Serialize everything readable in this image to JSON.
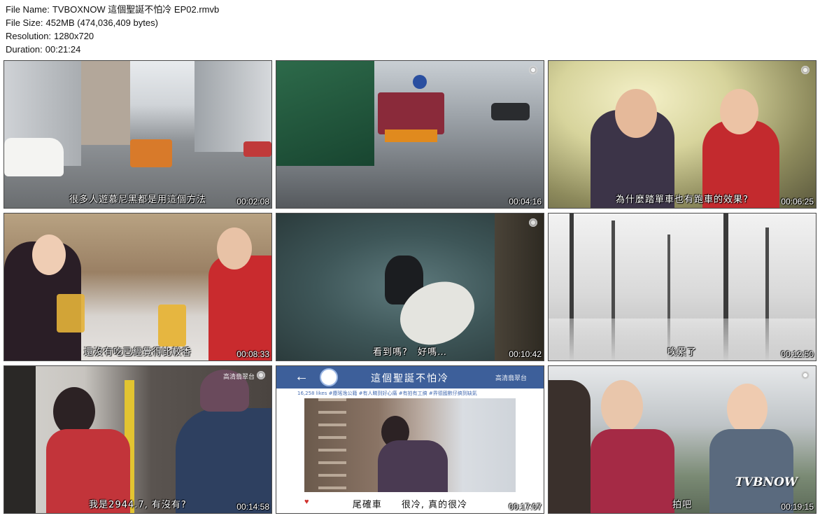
{
  "file_info": {
    "name_label": "File Name:",
    "name_value": "TVBOXNOW 這個聖誕不怕冷 EP02.rmvb",
    "size_label": "File Size:",
    "size_value": "452MB (474,036,409 bytes)",
    "resolution_label": "Resolution:",
    "resolution_value": "1280x720",
    "duration_label": "Duration:",
    "duration_value": "00:21:24"
  },
  "thumbnails": [
    {
      "subtitle": "很多人遊慕尼黑都是用這個方法",
      "time": "00:02:08",
      "tvb": ""
    },
    {
      "subtitle": "",
      "time": "00:04:16",
      "tvb": ""
    },
    {
      "subtitle": "為什麼踏單車也有跑車的效果?",
      "time": "00:06:25",
      "tvb": ""
    },
    {
      "subtitle": "還沒有吃已經覺得比較香",
      "time": "00:08:33",
      "tvb": ""
    },
    {
      "subtitle": "看到嗎?　好嗎…",
      "time": "00:10:42",
      "tvb": ""
    },
    {
      "subtitle": "唉累了",
      "time": "00:12:50",
      "tvb": ""
    },
    {
      "subtitle": "我是2944.7, 有沒有?",
      "time": "00:14:58",
      "tvb": "高清翡翠台"
    },
    {
      "subtitle": "尾確車　　很冷, 真的很冷",
      "time": "00:17:07",
      "tvb": "高清翡翠台",
      "post_title": "這個聖誕不怕冷",
      "post_tags": "16,258 likes  #塵瑤逸公籍 #有人睇到好心痛 #有拍有工搞 #界德國數仔搞到缺氣"
    },
    {
      "subtitle": "拍吧",
      "time": "00:19:15",
      "tvb": "",
      "watermark": "TVBNOW"
    }
  ],
  "colors": {
    "border": "#4a4a4a",
    "post_bar": "#3d5f9a"
  }
}
